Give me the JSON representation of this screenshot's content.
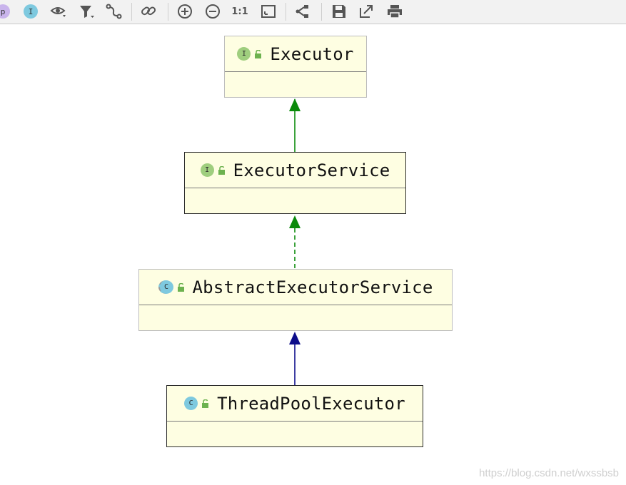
{
  "toolbar": {
    "items": [
      {
        "name": "show-properties-button",
        "glyph": "p"
      },
      {
        "name": "show-interfaces-button",
        "glyph": "I"
      },
      {
        "name": "visibility-eye-icon",
        "glyph": ""
      },
      {
        "name": "filter-icon",
        "glyph": ""
      },
      {
        "name": "edge-route-icon",
        "glyph": ""
      },
      {
        "name": "link-icon",
        "glyph": ""
      },
      {
        "name": "zoom-in-icon",
        "glyph": ""
      },
      {
        "name": "zoom-out-icon",
        "glyph": ""
      },
      {
        "name": "actual-size-button",
        "glyph": "1:1"
      },
      {
        "name": "fit-content-icon",
        "glyph": ""
      },
      {
        "name": "layout-icon",
        "glyph": ""
      },
      {
        "name": "save-icon",
        "glyph": ""
      },
      {
        "name": "export-icon",
        "glyph": ""
      },
      {
        "name": "print-icon",
        "glyph": ""
      }
    ],
    "actual_size_label": "1:1",
    "props_label": "p",
    "interface_label": "I"
  },
  "diagram": {
    "nodes": [
      {
        "id": "executor",
        "name": "Executor",
        "kind": "interface",
        "kind_glyph": "I"
      },
      {
        "id": "executorservice",
        "name": "ExecutorService",
        "kind": "interface",
        "kind_glyph": "I"
      },
      {
        "id": "abstractexecutorservice",
        "name": "AbstractExecutorService",
        "kind": "abstract-class",
        "kind_glyph": "C"
      },
      {
        "id": "threadpoolexecutor",
        "name": "ThreadPoolExecutor",
        "kind": "class",
        "kind_glyph": "C"
      }
    ],
    "edges": [
      {
        "from": "executorservice",
        "to": "executor",
        "type": "extends",
        "color": "#0a8a0a"
      },
      {
        "from": "abstractexecutorservice",
        "to": "executorservice",
        "type": "implements",
        "color": "#0a8a0a"
      },
      {
        "from": "threadpoolexecutor",
        "to": "abstractexecutorservice",
        "type": "extends",
        "color": "#0c0c8a"
      }
    ]
  },
  "watermark": "https://blog.csdn.net/wxssbsb",
  "colors": {
    "node_fill": "#fefee2",
    "interface_badge": "#9fce7e",
    "class_badge": "#7ec9df",
    "interface_edge": "#0a8a0a",
    "class_edge": "#0c0c8a"
  }
}
